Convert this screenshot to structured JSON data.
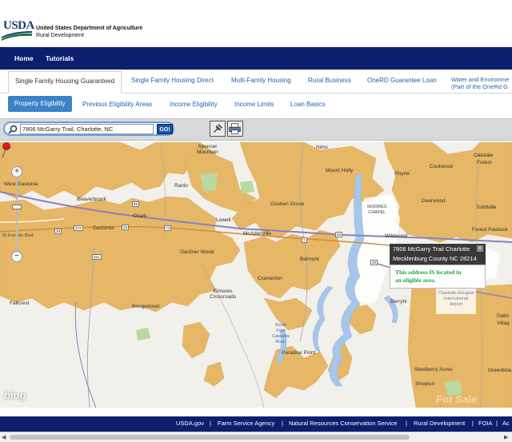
{
  "header": {
    "logo_text": "USDA",
    "agency_line1": "United States Department of Agriculture",
    "agency_line2": "Rural Development"
  },
  "nav": {
    "items": [
      "Home",
      "Tutorials"
    ]
  },
  "program_tabs": [
    "Single Family Housing Guaranteed",
    "Single Family Housing Direct",
    "Multi-Family Housing",
    "Rural Business",
    "OneRD Guarantee Loan",
    "Water and Environme",
    "(Part of the OneRd G"
  ],
  "sub_tabs": [
    "Property Eligibility",
    "Previous Eligibility Areas",
    "Income Eligibility",
    "Income Limits",
    "Loan Basics"
  ],
  "search": {
    "value": "7806 McGarry Trail, Charlotte, NC",
    "go_label": "GO!"
  },
  "map": {
    "places": {
      "spencer_mountain": "Spencer\nMountain",
      "nims": "Nims",
      "oakdale": "Oakdale",
      "forest": "Forest",
      "mount_holly": "Mount Holly",
      "rhyne": "Rhyne",
      "coulwood": "Coulwood",
      "west_gastonia": "West Gastonia",
      "ranlo": "Ranlo",
      "goshen_grove": "Goshen Grove",
      "moores_chapel": "MOORES\nCHAPEL",
      "deerwood": "Deerwood",
      "toddville": "Toddville",
      "beaverbrook": "Beaverbrook",
      "ozark": "Ozark",
      "lowell": "Lowell",
      "forest_pawtuck": "Forest Pawtuck",
      "gastonia": "Gastonia",
      "mcadenville": "McAdenville",
      "wildwood": "Wildwood",
      "w_franklin_blvd": "W Franklin Blvd",
      "gardner_wood": "Gardner Wood",
      "belmont": "Belmont",
      "cramerton": "Cramerton",
      "elmores_crossroads": "Elmores\nCrossroads",
      "fallcrest": "Fallcrest",
      "boogertown": "Boogertown",
      "berryhill": "Berryhi",
      "charlotte_douglas": "Charlotte-Douglas\nInternational\nAirport",
      "dalto": "Dalto",
      "villag": "Villag",
      "south_fork": "South\nFork\nCatawba\nRiver",
      "paradise_point": "Paradise Point",
      "steelberry_acres": "Steelberry Acres",
      "greenbriar": "Greenbria",
      "shopton": "Shopton",
      "bing_logo": "bing",
      "watermark": "For Sale"
    },
    "shields": [
      "29",
      "274",
      "29",
      "74",
      "321",
      "7",
      "85",
      "29",
      "85"
    ]
  },
  "popup": {
    "address_line1": "7806 McGarry Trail Charlotte",
    "address_line2": "Mecklenburg County NC 28214",
    "result_line1": "This address IS located in",
    "result_line2": "an eligible area.",
    "close_symbol": "x"
  },
  "zoom": {
    "plus": "+",
    "minus": "−"
  },
  "footer": {
    "links": [
      "USDA.gov",
      "Farm Service Agency",
      "Natural Resources Conservation Service",
      "Rural Development",
      "FOIA",
      "Ac"
    ]
  },
  "colors": {
    "nav_bg": "#0c1f6e",
    "eligible_fill": "#e6b767",
    "ineligible_fill": "#f2f0ea",
    "water": "#a7c7ea",
    "eligible_text": "#23a53a"
  }
}
